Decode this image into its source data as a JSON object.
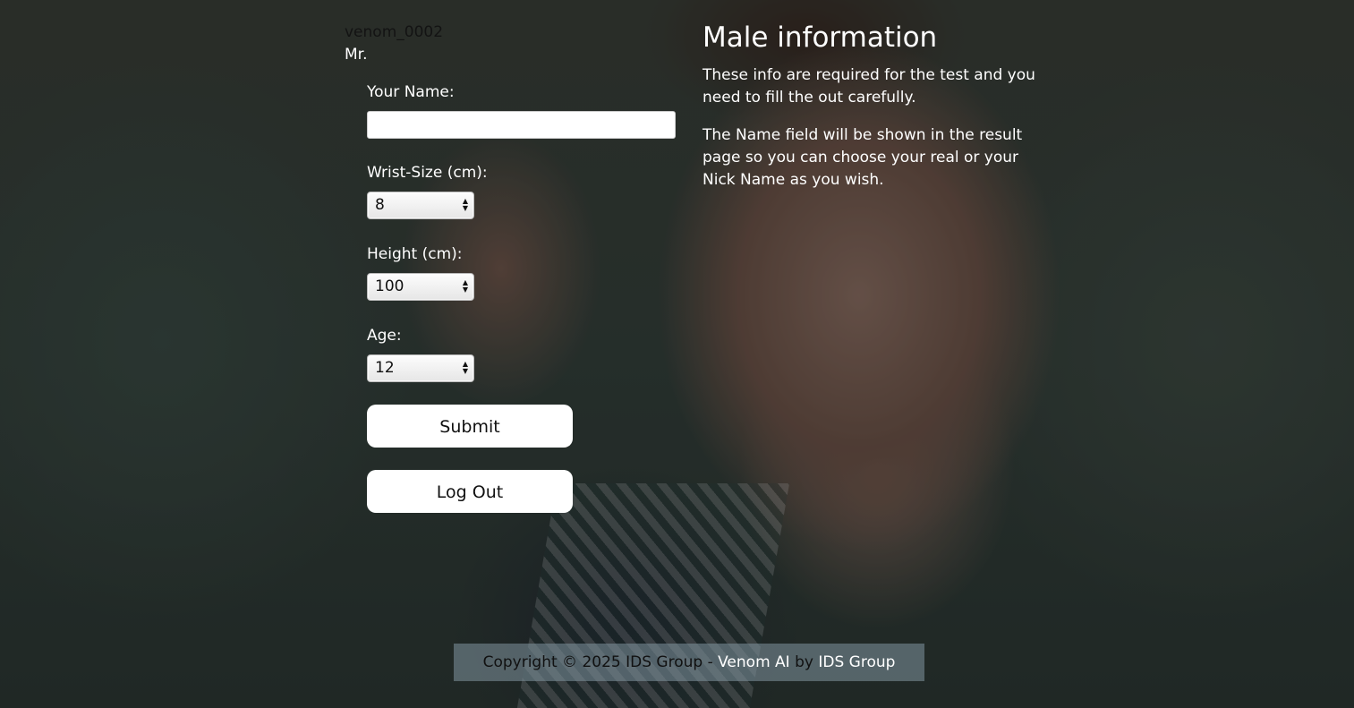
{
  "user": {
    "username": "venom_0002",
    "salutation": "Mr."
  },
  "form": {
    "name_label": "Your Name:",
    "name_value": "",
    "wrist_label": "Wrist-Size (cm):",
    "wrist_value": "8",
    "height_label": "Height (cm):",
    "height_value": "100",
    "age_label": "Age:",
    "age_value": "12",
    "submit_label": "Submit",
    "logout_label": "Log Out"
  },
  "info": {
    "title": "Male information",
    "paragraph1": "These info are required for the test and you need to fill the out carefully.",
    "paragraph2": "The Name field will be shown in the result page so you can choose your real or your Nick Name as you wish."
  },
  "footer": {
    "prefix": "Copyright © 2025 IDS Group - ",
    "product_link": "Venom AI",
    "by": " by ",
    "company_link": "IDS Group"
  },
  "colors": {
    "text_light": "#ffffff",
    "text_dark": "#111111",
    "footer_bg": "rgba(130,150,160,0.55)"
  },
  "icons": {
    "select_arrows": "up-down-arrows-icon"
  }
}
